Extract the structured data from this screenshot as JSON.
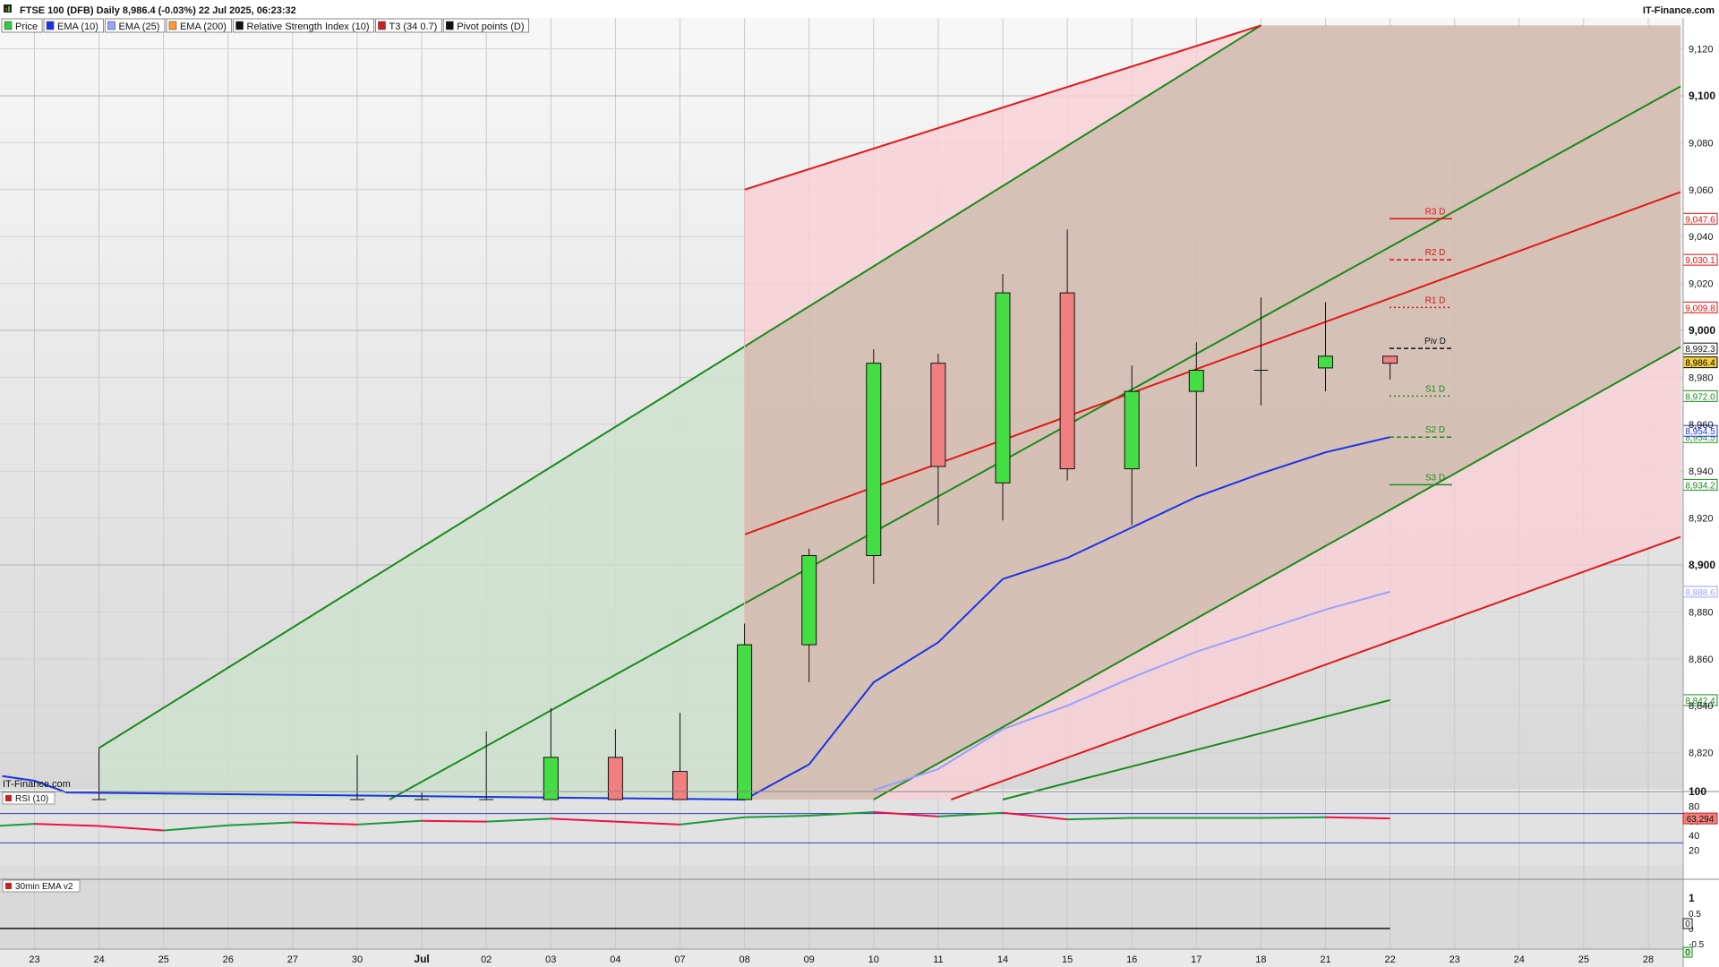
{
  "header": {
    "title": "FTSE 100 (DFB) Daily 8,986.4 (-0.03%) 22 Jul 2025, 06:23:32",
    "brand": "IT-Finance.com",
    "legend": [
      {
        "label": "Price",
        "color": "#2ecc40"
      },
      {
        "label": "EMA (10)",
        "color": "#1a33e6"
      },
      {
        "label": "EMA (25)",
        "color": "#9aa0ff"
      },
      {
        "label": "EMA (200)",
        "color": "#ff9a2e"
      },
      {
        "label": "Relative Strength Index (10)",
        "color": "#111111"
      },
      {
        "label": "T3 (34 0.7)",
        "color": "#cc2020"
      },
      {
        "label": "Pivot points (D)",
        "color": "#111111"
      }
    ]
  },
  "watermark": "IT-Finance.com",
  "chart_data": {
    "type": "candlestick",
    "dates": [
      "23",
      "24",
      "25",
      "26",
      "27",
      "30",
      "Jul",
      "02",
      "03",
      "04",
      "07",
      "08",
      "09",
      "10",
      "11",
      "14",
      "15",
      "16",
      "17",
      "18",
      "21",
      "22",
      "23",
      "24",
      "25",
      "28"
    ],
    "date_index_labels": [
      0,
      1,
      2,
      3,
      4,
      5,
      6,
      7,
      8,
      9,
      10,
      11,
      12,
      13,
      14,
      15,
      16,
      17,
      18,
      19,
      20,
      21,
      22,
      23,
      24,
      25
    ],
    "ylim": [
      8800,
      9130
    ],
    "yticks": [
      "9,120",
      "9,100",
      "9,080",
      "9,060",
      "9,040",
      "9,020",
      "9,000",
      "8,980",
      "8,960",
      "8,940",
      "8,920",
      "8,900",
      "8,880",
      "8,860",
      "8,840",
      "8,820"
    ],
    "candles": [
      {
        "i": 1,
        "o": 8800,
        "h": 8822,
        "l": 8800,
        "c": 8800
      },
      {
        "i": 5,
        "o": 8800,
        "h": 8819,
        "l": 8800,
        "c": 8800
      },
      {
        "i": 6,
        "o": 8800,
        "h": 8803,
        "l": 8800,
        "c": 8800
      },
      {
        "i": 7,
        "o": 8800,
        "h": 8829,
        "l": 8800,
        "c": 8800
      },
      {
        "i": 8,
        "o": 8800,
        "h": 8839,
        "l": 8800,
        "c": 8818
      },
      {
        "i": 9,
        "o": 8818,
        "h": 8830,
        "l": 8800,
        "c": 8800
      },
      {
        "i": 10,
        "o": 8812,
        "h": 8837,
        "l": 8800,
        "c": 8800
      },
      {
        "i": 11,
        "o": 8800,
        "h": 8875,
        "l": 8800,
        "c": 8866
      },
      {
        "i": 12,
        "o": 8866,
        "h": 8907,
        "l": 8850,
        "c": 8904
      },
      {
        "i": 13,
        "o": 8904,
        "h": 8992,
        "l": 8892,
        "c": 8986
      },
      {
        "i": 14,
        "o": 8986,
        "h": 8990,
        "l": 8917,
        "c": 8942
      },
      {
        "i": 15,
        "o": 8935,
        "h": 9024,
        "l": 8919,
        "c": 9016
      },
      {
        "i": 16,
        "o": 9016,
        "h": 9043,
        "l": 8936,
        "c": 8941
      },
      {
        "i": 17,
        "o": 8941,
        "h": 8985,
        "l": 8917,
        "c": 8974
      },
      {
        "i": 18,
        "o": 8974,
        "h": 8995,
        "l": 8942,
        "c": 8983
      },
      {
        "i": 19,
        "o": 8983,
        "h": 9014,
        "l": 8968,
        "c": 8983
      },
      {
        "i": 20,
        "o": 8984,
        "h": 9012,
        "l": 8974,
        "c": 8989
      },
      {
        "i": 21,
        "o": 8989,
        "h": 8989,
        "l": 8979,
        "c": 8986
      }
    ],
    "ema10": [
      {
        "i": -0.5,
        "v": 8810
      },
      {
        "i": 0,
        "v": 8808
      },
      {
        "i": 0.5,
        "v": 8803
      },
      {
        "i": 11,
        "v": 8800
      },
      {
        "i": 12,
        "v": 8815
      },
      {
        "i": 13,
        "v": 8850
      },
      {
        "i": 14,
        "v": 8867
      },
      {
        "i": 15,
        "v": 8894
      },
      {
        "i": 16,
        "v": 8903
      },
      {
        "i": 17,
        "v": 8916
      },
      {
        "i": 18,
        "v": 8929
      },
      {
        "i": 19,
        "v": 8939
      },
      {
        "i": 20,
        "v": 8948
      },
      {
        "i": 21,
        "v": 8954.5
      }
    ],
    "ema25": [
      {
        "i": 13,
        "v": 8804
      },
      {
        "i": 14,
        "v": 8813
      },
      {
        "i": 15,
        "v": 8830
      },
      {
        "i": 16,
        "v": 8840
      },
      {
        "i": 17,
        "v": 8852
      },
      {
        "i": 18,
        "v": 8863
      },
      {
        "i": 19,
        "v": 8872
      },
      {
        "i": 20,
        "v": 8881
      },
      {
        "i": 21,
        "v": 8888.6
      }
    ],
    "green_lower_line": [
      {
        "i": 15,
        "v": 8800
      },
      {
        "i": 21,
        "v": 8842.4
      }
    ],
    "channels": {
      "green": [
        {
          "x1": 1,
          "y1": 8822,
          "x2": 19,
          "y2": 9130
        },
        {
          "x1": 5.5,
          "y1": 8800,
          "x2": 25.5,
          "y2": 9104
        },
        {
          "x1": 13,
          "y1": 8800,
          "x2": 25.5,
          "y2": 8993
        }
      ],
      "red": [
        {
          "x1": 11,
          "y1": 9060,
          "x2": 19,
          "y2": 9130
        },
        {
          "x1": 11,
          "y1": 8913,
          "x2": 25.5,
          "y2": 9059
        },
        {
          "x1": 14.2,
          "y1": 8800,
          "x2": 25.5,
          "y2": 8912
        }
      ]
    },
    "band": {
      "x_start": 11,
      "green_start": 1
    },
    "pivots": [
      {
        "label": "R3 D",
        "value": 9047.6,
        "color": "#dd1111",
        "style": "solid",
        "tag": "9,047.6"
      },
      {
        "label": "R2 D",
        "value": 9030.1,
        "color": "#dd1111",
        "style": "dashed",
        "tag": "9,030.1"
      },
      {
        "label": "R1 D",
        "value": 9009.8,
        "color": "#dd1111",
        "style": "dotted",
        "tag": "9,009.8"
      },
      {
        "label": "Piv D",
        "value": 8992.3,
        "color": "#111111",
        "style": "dashed",
        "tag": "8,992.3"
      },
      {
        "label": "S1 D",
        "value": 8972.0,
        "color": "#1a8a1a",
        "style": "dotted",
        "tag": "8,972.0"
      },
      {
        "label": "S2 D",
        "value": 8954.5,
        "color": "#1a8a1a",
        "style": "dashed",
        "tag": "8,954.5"
      },
      {
        "label": "S3 D",
        "value": 8934.2,
        "color": "#1a8a1a",
        "style": "solid",
        "tag": "8,934.2"
      }
    ],
    "price_tags": [
      {
        "value": 8986.4,
        "text": "8,986.4",
        "bg": "#f4d03f",
        "fg": "#000000"
      },
      {
        "value": 8954.5,
        "text": "8,954.5",
        "bg": "#ffffff",
        "fg": "#1a33e6",
        "offset": -7
      },
      {
        "value": 8888.6,
        "text": "8,888.6",
        "bg": "#ffffff",
        "fg": "#9aa0ff"
      },
      {
        "value": 8842.4,
        "text": "8,842.4",
        "bg": "#ffffff",
        "fg": "#1a8a1a"
      }
    ],
    "rsi": {
      "label": "RSI (10)",
      "ylim": [
        0,
        100
      ],
      "ticks": [
        "100",
        "80",
        "60",
        "40",
        "20"
      ],
      "upper": 70,
      "lower": 30,
      "values": [
        {
          "i": -0.6,
          "v": 53
        },
        {
          "i": 0,
          "v": 56
        },
        {
          "i": 1,
          "v": 53
        },
        {
          "i": 2,
          "v": 47
        },
        {
          "i": 3,
          "v": 54
        },
        {
          "i": 4,
          "v": 58
        },
        {
          "i": 5,
          "v": 55
        },
        {
          "i": 6,
          "v": 60
        },
        {
          "i": 7,
          "v": 59
        },
        {
          "i": 8,
          "v": 63
        },
        {
          "i": 9,
          "v": 59
        },
        {
          "i": 10,
          "v": 55
        },
        {
          "i": 11,
          "v": 65
        },
        {
          "i": 12,
          "v": 67
        },
        {
          "i": 13,
          "v": 72
        },
        {
          "i": 14,
          "v": 66
        },
        {
          "i": 15,
          "v": 71
        },
        {
          "i": 16,
          "v": 62
        },
        {
          "i": 17,
          "v": 64
        },
        {
          "i": 18,
          "v": 64
        },
        {
          "i": 19,
          "v": 64
        },
        {
          "i": 20,
          "v": 65
        },
        {
          "i": 21,
          "v": 63.3
        }
      ],
      "tag": "63.294"
    },
    "ema30": {
      "label": "30min EMA v2",
      "ticks": [
        "1",
        "0.5",
        "0",
        "-0.5"
      ],
      "tag_top": "0",
      "tag_bottom": "0"
    }
  }
}
